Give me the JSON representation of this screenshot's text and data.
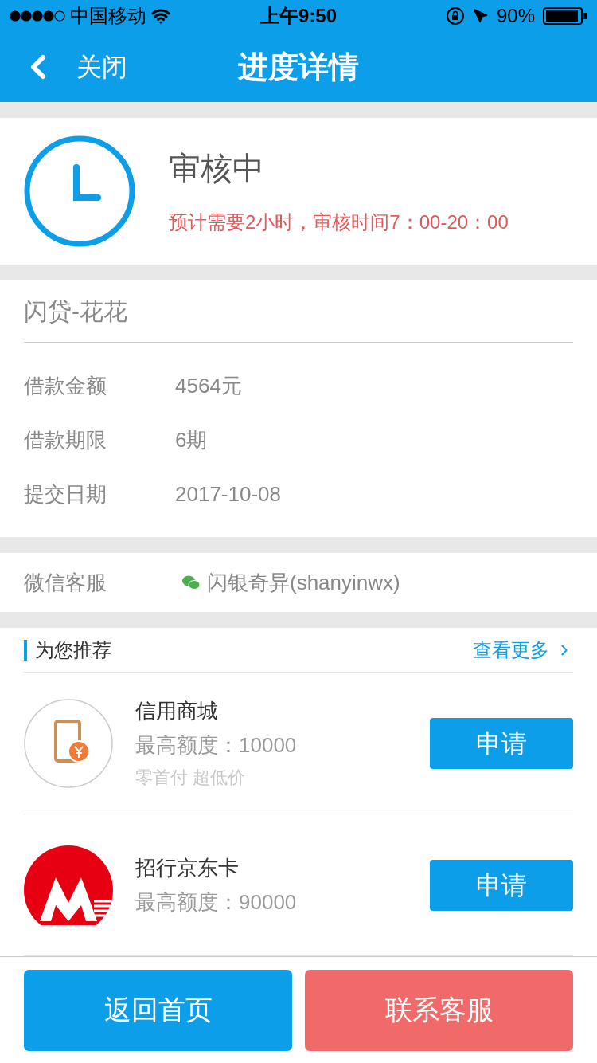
{
  "status_bar": {
    "carrier": "中国移动",
    "time": "上午9:50",
    "battery": "90%"
  },
  "nav": {
    "back": "关闭",
    "title": "进度详情"
  },
  "progress": {
    "status": "审核中",
    "note": "预计需要2小时，审核时间7：00-20：00"
  },
  "loan": {
    "product": "闪贷-花花",
    "fields": [
      {
        "label": "借款金额",
        "value": "4564元"
      },
      {
        "label": "借款期限",
        "value": "6期"
      },
      {
        "label": "提交日期",
        "value": "2017-10-08"
      }
    ]
  },
  "wechat": {
    "label": "微信客服",
    "value": "闪银奇异(shanyinwx)"
  },
  "recommend": {
    "title": "为您推荐",
    "more": "查看更多",
    "items": [
      {
        "kind": "phone",
        "name": "信用商城",
        "limit": "最高额度：10000",
        "tagline": "零首付 超低价",
        "button": "申请"
      },
      {
        "kind": "bank",
        "name": "招行京东卡",
        "limit": "最高额度：90000",
        "button": "申请"
      }
    ]
  },
  "footer": {
    "buttons": [
      {
        "label": "返回首页",
        "kind": "primary"
      },
      {
        "label": "联系客服",
        "kind": "danger"
      }
    ]
  }
}
